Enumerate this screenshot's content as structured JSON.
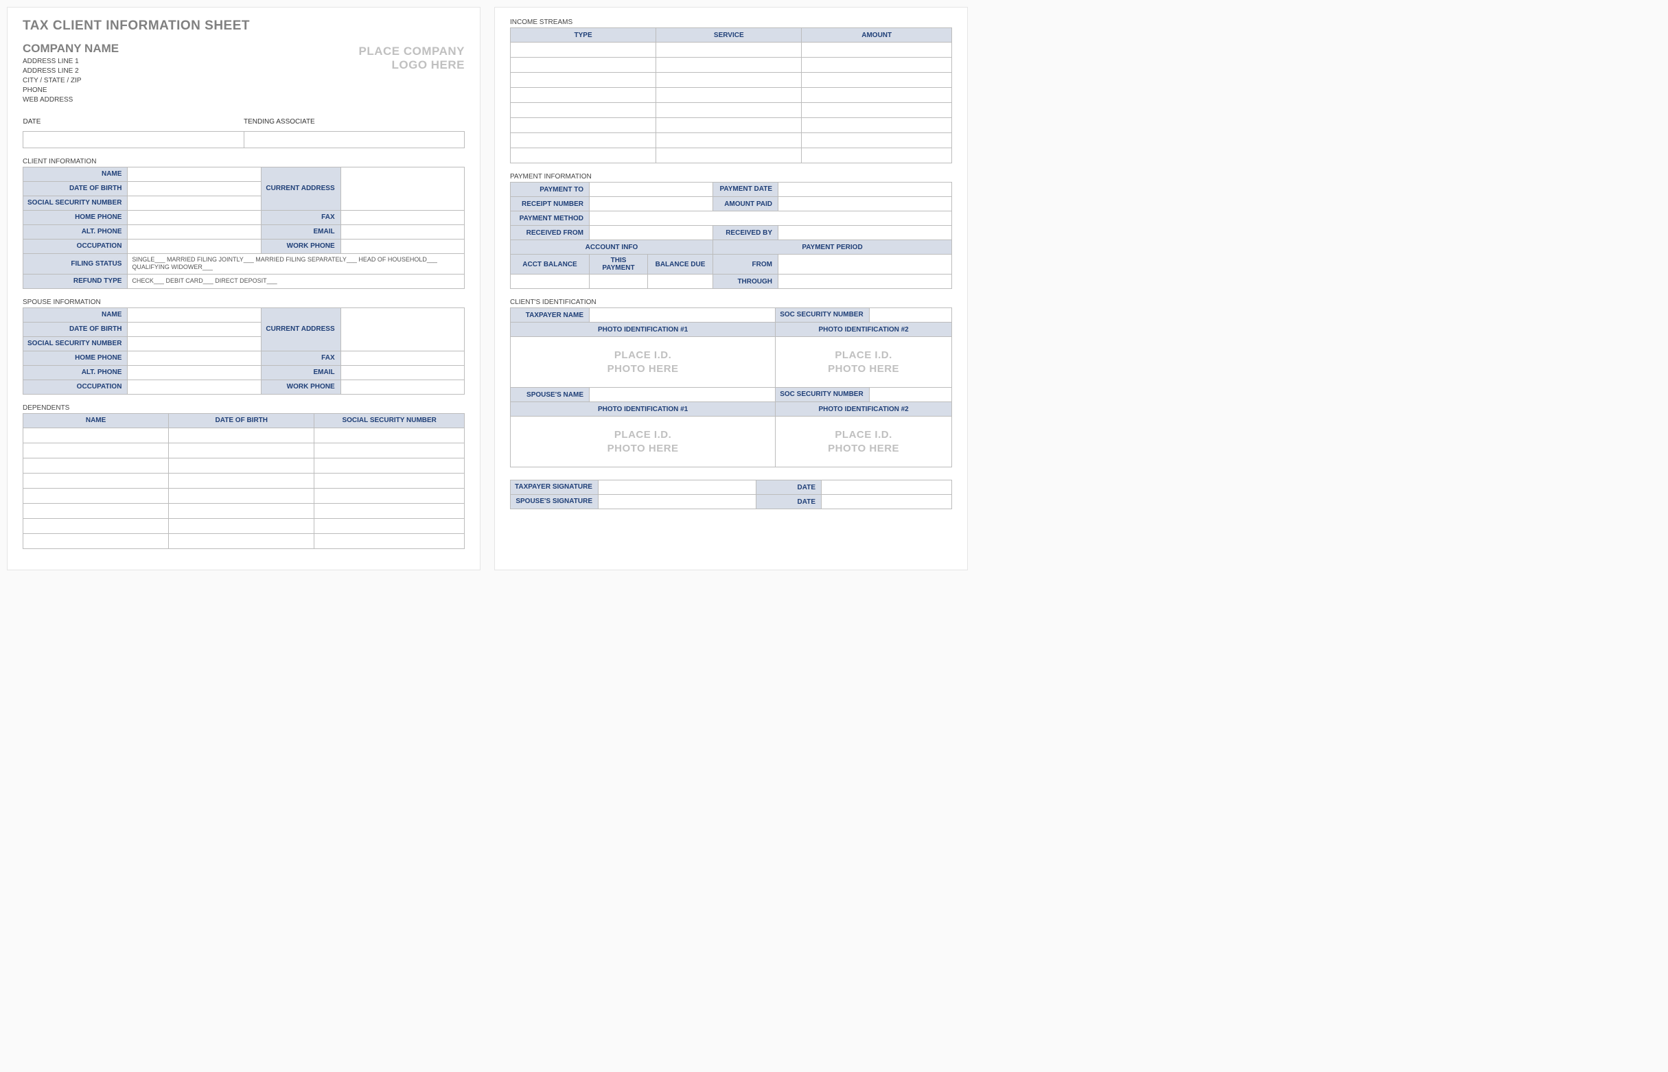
{
  "header": {
    "title": "TAX CLIENT INFORMATION SHEET",
    "company_name": "COMPANY NAME",
    "address1": "ADDRESS LINE 1",
    "address2": "ADDRESS LINE 2",
    "csz": "CITY / STATE / ZIP",
    "phone": "PHONE",
    "web": "WEB ADDRESS",
    "logo_line1": "PLACE COMPANY",
    "logo_line2": "LOGO HERE",
    "date_label": "DATE",
    "assoc_label": "TENDING ASSOCIATE"
  },
  "client_info": {
    "section": "CLIENT INFORMATION",
    "name": "NAME",
    "dob": "DATE OF BIRTH",
    "ssn": "SOCIAL SECURITY NUMBER",
    "home": "HOME PHONE",
    "alt": "ALT. PHONE",
    "occ": "OCCUPATION",
    "filing": "FILING STATUS",
    "refund": "REFUND TYPE",
    "curaddr": "CURRENT ADDRESS",
    "fax": "FAX",
    "email": "EMAIL",
    "work": "WORK PHONE",
    "filing_opts": "SINGLE___   MARRIED FILING JOINTLY___   MARRIED FILING SEPARATELY___   HEAD OF HOUSEHOLD___   QUALIFYING WIDOWER___",
    "refund_opts": "CHECK___   DEBIT CARD___   DIRECT DEPOSIT___"
  },
  "spouse_info": {
    "section": "SPOUSE INFORMATION",
    "name": "NAME",
    "dob": "DATE OF BIRTH",
    "ssn": "SOCIAL SECURITY NUMBER",
    "home": "HOME PHONE",
    "alt": "ALT. PHONE",
    "occ": "OCCUPATION",
    "curaddr": "CURRENT ADDRESS",
    "fax": "FAX",
    "email": "EMAIL",
    "work": "WORK PHONE"
  },
  "dependents": {
    "section": "DEPENDENTS",
    "col_name": "NAME",
    "col_dob": "DATE OF BIRTH",
    "col_ssn": "SOCIAL SECURITY NUMBER",
    "rows": 8
  },
  "income": {
    "section": "INCOME STREAMS",
    "col_type": "TYPE",
    "col_service": "SERVICE",
    "col_amount": "AMOUNT",
    "rows": 8
  },
  "payment": {
    "section": "PAYMENT INFORMATION",
    "payment_to": "PAYMENT TO",
    "payment_date": "PAYMENT DATE",
    "receipt": "RECEIPT NUMBER",
    "amount_paid": "AMOUNT PAID",
    "method": "PAYMENT METHOD",
    "received_from": "RECEIVED FROM",
    "received_by": "RECEIVED BY",
    "acct_info": "ACCOUNT INFO",
    "payment_period": "PAYMENT PERIOD",
    "acct_balance": "ACCT BALANCE",
    "this_payment": "THIS PAYMENT",
    "balance_due": "BALANCE DUE",
    "from": "FROM",
    "through": "THROUGH"
  },
  "client_id": {
    "section": "CLIENT'S IDENTIFICATION",
    "taxpayer_name": "TAXPAYER NAME",
    "soc_sec": "SOC SECURITY NUMBER",
    "photo1": "PHOTO IDENTIFICATION #1",
    "photo2": "PHOTO IDENTIFICATION #2",
    "id_ph1": "PLACE I.D.",
    "id_ph2": "PHOTO HERE",
    "spouse_name": "SPOUSE'S NAME"
  },
  "sign": {
    "taxpayer_sig": "TAXPAYER SIGNATURE",
    "spouse_sig": "SPOUSE'S SIGNATURE",
    "date": "DATE"
  }
}
